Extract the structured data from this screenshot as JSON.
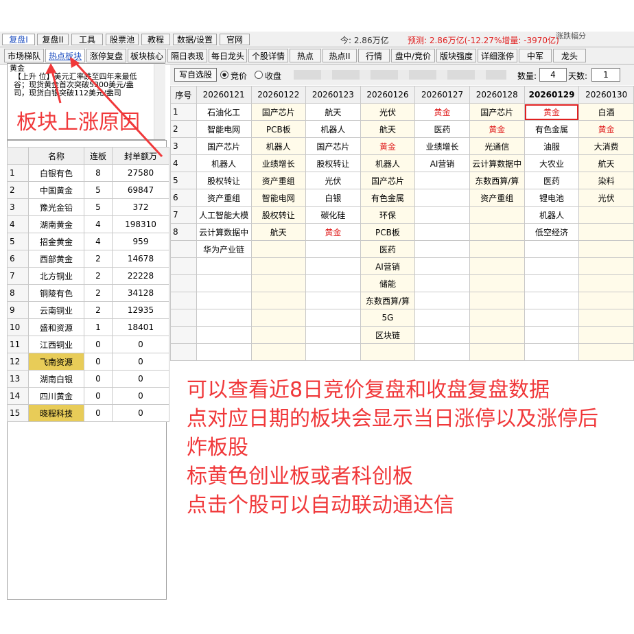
{
  "menu": {
    "tabs": [
      "复盘I",
      "复盘II",
      "工具",
      "股票池",
      "教程",
      "数据/设置",
      "官网"
    ],
    "active": 0,
    "today": "今: 2.86万亿",
    "prediction": "预测: 2.86万亿(-12.27%增量: -3970亿)",
    "extra": "涨跌幅分"
  },
  "subtabs": {
    "items": [
      "市场梯队",
      "热点板块",
      "涨停复盘",
      "板块核心",
      "隔日表现",
      "每日龙头",
      "个股详情",
      "热点",
      "热点II",
      "行情",
      "盘中/竞价",
      "版块强度",
      "详细涨停",
      "中军",
      "龙头"
    ],
    "active": 1
  },
  "news": {
    "title": "黄金",
    "body": "【上升 位】美元汇率跌至四年来最低谷；现货黄金首次突破5300美元/盎司，现货白银突破112美元/盎司"
  },
  "left_table": {
    "headers": [
      "",
      "名称",
      "连板",
      "封单额万"
    ],
    "rows": [
      {
        "idx": "1",
        "name": "白银有色",
        "lb": "8",
        "amt": "27580",
        "hl": false
      },
      {
        "idx": "2",
        "name": "中国黄金",
        "lb": "5",
        "amt": "69847",
        "hl": false
      },
      {
        "idx": "3",
        "name": "豫光金铅",
        "lb": "5",
        "amt": "372",
        "hl": false
      },
      {
        "idx": "4",
        "name": "湖南黄金",
        "lb": "4",
        "amt": "198310",
        "hl": false
      },
      {
        "idx": "5",
        "name": "招金黄金",
        "lb": "4",
        "amt": "959",
        "hl": false
      },
      {
        "idx": "6",
        "name": "西部黄金",
        "lb": "2",
        "amt": "14678",
        "hl": false
      },
      {
        "idx": "7",
        "name": "北方铜业",
        "lb": "2",
        "amt": "22228",
        "hl": false
      },
      {
        "idx": "8",
        "name": "铜陵有色",
        "lb": "2",
        "amt": "34128",
        "hl": false
      },
      {
        "idx": "9",
        "name": "云南铜业",
        "lb": "2",
        "amt": "12935",
        "hl": false
      },
      {
        "idx": "10",
        "name": "盛和资源",
        "lb": "1",
        "amt": "18401",
        "hl": false
      },
      {
        "idx": "11",
        "name": "江西铜业",
        "lb": "0",
        "amt": "0",
        "hl": false
      },
      {
        "idx": "12",
        "name": "飞南资源",
        "lb": "0",
        "amt": "0",
        "hl": true
      },
      {
        "idx": "13",
        "name": "湖南白银",
        "lb": "0",
        "amt": "0",
        "hl": false
      },
      {
        "idx": "14",
        "name": "四川黄金",
        "lb": "0",
        "amt": "0",
        "hl": false
      },
      {
        "idx": "15",
        "name": "晓程科技",
        "lb": "0",
        "amt": "0",
        "hl": true
      }
    ]
  },
  "controls": {
    "write_button": "写自选股",
    "radio_bid": "竞价",
    "radio_close": "收盘",
    "count_label": "数量:",
    "count_value": "4",
    "days_label": "天数:",
    "days_value": "1"
  },
  "grid": {
    "headers": [
      "序号",
      "20260121",
      "20260122",
      "20260123",
      "20260126",
      "20260127",
      "20260128",
      "20260129",
      "20260130"
    ],
    "bold_col": 7,
    "rows": [
      [
        "1",
        "石油化工",
        "国产芯片",
        "航天",
        "光伏",
        "黄金",
        "国产芯片",
        "黄金",
        "白酒"
      ],
      [
        "2",
        "智能电网",
        "PCB板",
        "机器人",
        "航天",
        "医药",
        "黄金",
        "有色金属",
        "黄金"
      ],
      [
        "3",
        "国产芯片",
        "机器人",
        "国产芯片",
        "黄金",
        "业绩增长",
        "光通信",
        "油服",
        "大消费"
      ],
      [
        "4",
        "机器人",
        "业绩增长",
        "股权转让",
        "机器人",
        "AI营销",
        "云计算数据中",
        "大农业",
        "航天"
      ],
      [
        "5",
        "股权转让",
        "资产重组",
        "光伏",
        "国产芯片",
        "",
        "东数西算/算",
        "医药",
        "染料"
      ],
      [
        "6",
        "资产重组",
        "智能电网",
        "白银",
        "有色金属",
        "",
        "资产重组",
        "锂电池",
        "光伏"
      ],
      [
        "7",
        "人工智能大模",
        "股权转让",
        "碳化硅",
        "环保",
        "",
        "",
        "机器人",
        ""
      ],
      [
        "8",
        "云计算数据中",
        "航天",
        "黄金",
        "PCB板",
        "",
        "",
        "低空经济",
        ""
      ],
      [
        "",
        "华为产业链",
        "",
        "",
        "医药",
        "",
        "",
        "",
        ""
      ],
      [
        "",
        "",
        "",
        "",
        "AI营销",
        "",
        "",
        "",
        ""
      ],
      [
        "",
        "",
        "",
        "",
        "储能",
        "",
        "",
        "",
        ""
      ],
      [
        "",
        "",
        "",
        "",
        "东数西算/算",
        "",
        "",
        "",
        ""
      ],
      [
        "",
        "",
        "",
        "",
        "5G",
        "",
        "",
        "",
        ""
      ],
      [
        "",
        "",
        "",
        "",
        "区块链",
        "",
        "",
        "",
        ""
      ],
      [
        "",
        "",
        "",
        "",
        "",
        "",
        "",
        "",
        ""
      ]
    ]
  },
  "annotations": {
    "reason": "板块上涨原因",
    "lines": [
      "可以查看近8日竞价复盘和收盘复盘数据",
      "点对应日期的板块会显示当日涨停以及涨停后",
      "炸板股",
      "标黄色创业板或者科创板",
      "点击个股可以自动联动通达信"
    ]
  }
}
